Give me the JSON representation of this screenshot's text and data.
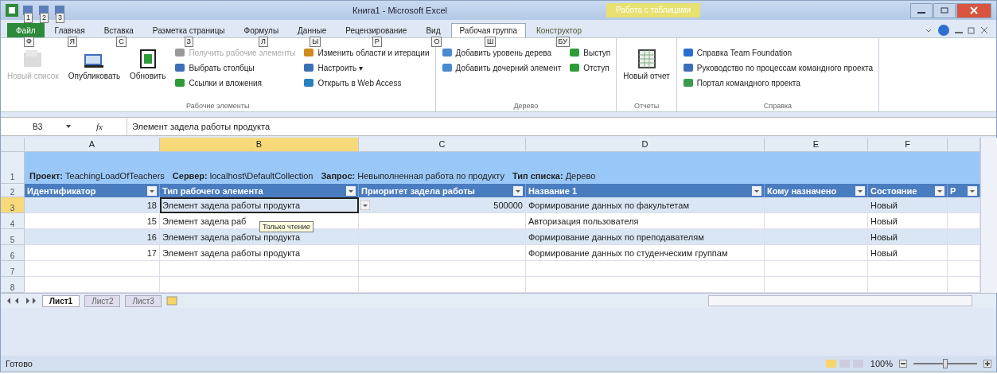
{
  "window": {
    "title": "Книга1 - Microsoft Excel",
    "contextual_tab": "Работа с таблицами"
  },
  "quick_access": [
    {
      "keytip": "1"
    },
    {
      "keytip": "2"
    },
    {
      "keytip": "3"
    }
  ],
  "tabs": [
    {
      "label": "Файл",
      "keytip": "Ф",
      "selected": false,
      "kind": "file"
    },
    {
      "label": "Главная",
      "keytip": "Я",
      "selected": false,
      "kind": "normal"
    },
    {
      "label": "Вставка",
      "keytip": "С",
      "selected": false,
      "kind": "normal"
    },
    {
      "label": "Разметка страницы",
      "keytip": "З",
      "selected": false,
      "kind": "normal"
    },
    {
      "label": "Формулы",
      "keytip": "Л",
      "selected": false,
      "kind": "normal"
    },
    {
      "label": "Данные",
      "keytip": "Ы",
      "selected": false,
      "kind": "normal"
    },
    {
      "label": "Рецензирование",
      "keytip": "Р",
      "selected": false,
      "kind": "normal"
    },
    {
      "label": "Вид",
      "keytip": "О",
      "selected": false,
      "kind": "normal"
    },
    {
      "label": "Рабочая группа",
      "keytip": "Ш",
      "selected": true,
      "kind": "normal"
    },
    {
      "label": "Конструктор",
      "keytip": "БУ",
      "selected": false,
      "kind": "contextual"
    }
  ],
  "ribbon": [
    {
      "label": "Рабочие элементы",
      "columns": [
        [
          {
            "label": "Новый список",
            "kind": "large",
            "disabled": true
          }
        ],
        [
          {
            "label": "Опубликовать",
            "kind": "large",
            "disabled": false
          }
        ],
        [
          {
            "label": "Обновить",
            "kind": "large",
            "disabled": false
          }
        ],
        [
          {
            "label": "Получить рабочие элементы",
            "kind": "small",
            "disabled": true
          },
          {
            "label": "Выбрать столбцы",
            "kind": "small",
            "disabled": false
          },
          {
            "label": "Ссылки и вложения",
            "kind": "small",
            "disabled": false
          }
        ],
        [
          {
            "label": "Изменить области и итерации",
            "kind": "small",
            "disabled": false
          },
          {
            "label": "Настроить ▾",
            "kind": "small",
            "disabled": false
          },
          {
            "label": "Открыть в Web Access",
            "kind": "small",
            "disabled": false
          }
        ]
      ]
    },
    {
      "label": "Дерево",
      "columns": [
        [
          {
            "label": "Добавить уровень дерева",
            "kind": "small",
            "disabled": false
          },
          {
            "label": "Добавить дочерний элемент",
            "kind": "small",
            "disabled": false
          }
        ],
        [
          {
            "label": "Выступ",
            "kind": "small",
            "disabled": false
          },
          {
            "label": "Отступ",
            "kind": "small",
            "disabled": false
          }
        ]
      ]
    },
    {
      "label": "Отчеты",
      "columns": [
        [
          {
            "label": "Новый отчет",
            "kind": "large",
            "disabled": false
          }
        ]
      ]
    },
    {
      "label": "Справка",
      "columns": [
        [
          {
            "label": "Справка Team Foundation",
            "kind": "small",
            "disabled": false
          },
          {
            "label": "Руководство по процессам командного проекта",
            "kind": "small",
            "disabled": false
          },
          {
            "label": "Портал командного проекта",
            "kind": "small",
            "disabled": false
          }
        ]
      ]
    }
  ],
  "formula_bar": {
    "name_box": "B3",
    "function_button": "fx",
    "formula": "Элемент задела работы продукта"
  },
  "sheet": {
    "columns": [
      {
        "label": "A",
        "selected": false
      },
      {
        "label": "B",
        "selected": true
      },
      {
        "label": "C",
        "selected": false
      },
      {
        "label": "D",
        "selected": false
      },
      {
        "label": "E",
        "selected": false
      },
      {
        "label": "F",
        "selected": false
      }
    ],
    "info_row": "1",
    "header_row": "2",
    "info": [
      {
        "label": "Проект:",
        "value": "TeachingLoadOfTeachers"
      },
      {
        "label": "Сервер:",
        "value": "localhost\\DefaultCollection"
      },
      {
        "label": "Запрос:",
        "value": "Невыполненная работа по продукту"
      },
      {
        "label": "Тип списка:",
        "value": "Дерево"
      }
    ],
    "headers": [
      "Идентификатор",
      "Тип рабочего элемента",
      "Приоритет задела работы",
      "Название 1",
      "Кому назначено",
      "Состояние",
      "Р"
    ],
    "rows": [
      {
        "number": "3",
        "selected": true,
        "cells": [
          "18",
          "Элемент задела работы продукта",
          "500000",
          "Формирование данных по факультетам",
          "",
          "Новый"
        ]
      },
      {
        "number": "4",
        "selected": false,
        "cells": [
          "15",
          "Элемент задела раб",
          "",
          "Авторизация пользователя",
          "",
          "Новый"
        ],
        "tooltip": "Только чтение"
      },
      {
        "number": "5",
        "selected": false,
        "cells": [
          "16",
          "Элемент задела работы продукта",
          "",
          "Формирование данных по преподавателям",
          "",
          "Новый"
        ]
      },
      {
        "number": "6",
        "selected": false,
        "cells": [
          "17",
          "Элемент задела работы продукта",
          "",
          "Формирование данных по студенческим группам",
          "",
          "Новый"
        ]
      },
      {
        "number": "7",
        "selected": false,
        "cells": [
          "",
          "",
          "",
          "",
          "",
          ""
        ]
      },
      {
        "number": "8",
        "selected": false,
        "cells": [
          "",
          "",
          "",
          "",
          "",
          ""
        ]
      }
    ]
  },
  "sheet_tabs": [
    {
      "label": "Лист1",
      "selected": true
    },
    {
      "label": "Лист2",
      "selected": false
    },
    {
      "label": "Лист3",
      "selected": false
    }
  ],
  "status_bar": {
    "status": "Готово",
    "zoom": "100%",
    "zoom_slider": {
      "level": 0.5
    }
  }
}
